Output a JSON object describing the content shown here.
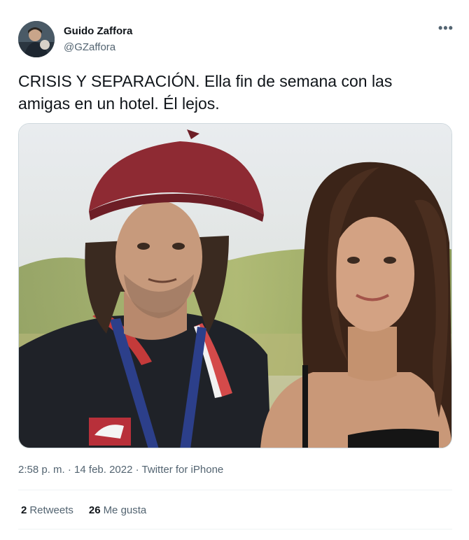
{
  "author": {
    "name": "Guido Zaffora",
    "handle": "@GZaffora"
  },
  "more_label": "•••",
  "tweet": {
    "text": "CRISIS Y SEPARACIÓN. Ella fin de semana con las amigas en un hotel. Él lejos."
  },
  "meta": {
    "time": "2:58 p. m.",
    "sep1": " · ",
    "date": "14 feb. 2022",
    "sep2": " · ",
    "source": "Twitter for iPhone"
  },
  "stats": {
    "retweets_count": "2",
    "retweets_label": "Retweets",
    "likes_count": "26",
    "likes_label": "Me gusta"
  },
  "colors": {
    "text_primary": "#0f1419",
    "text_secondary": "#536471",
    "divider": "#eff3f4"
  }
}
